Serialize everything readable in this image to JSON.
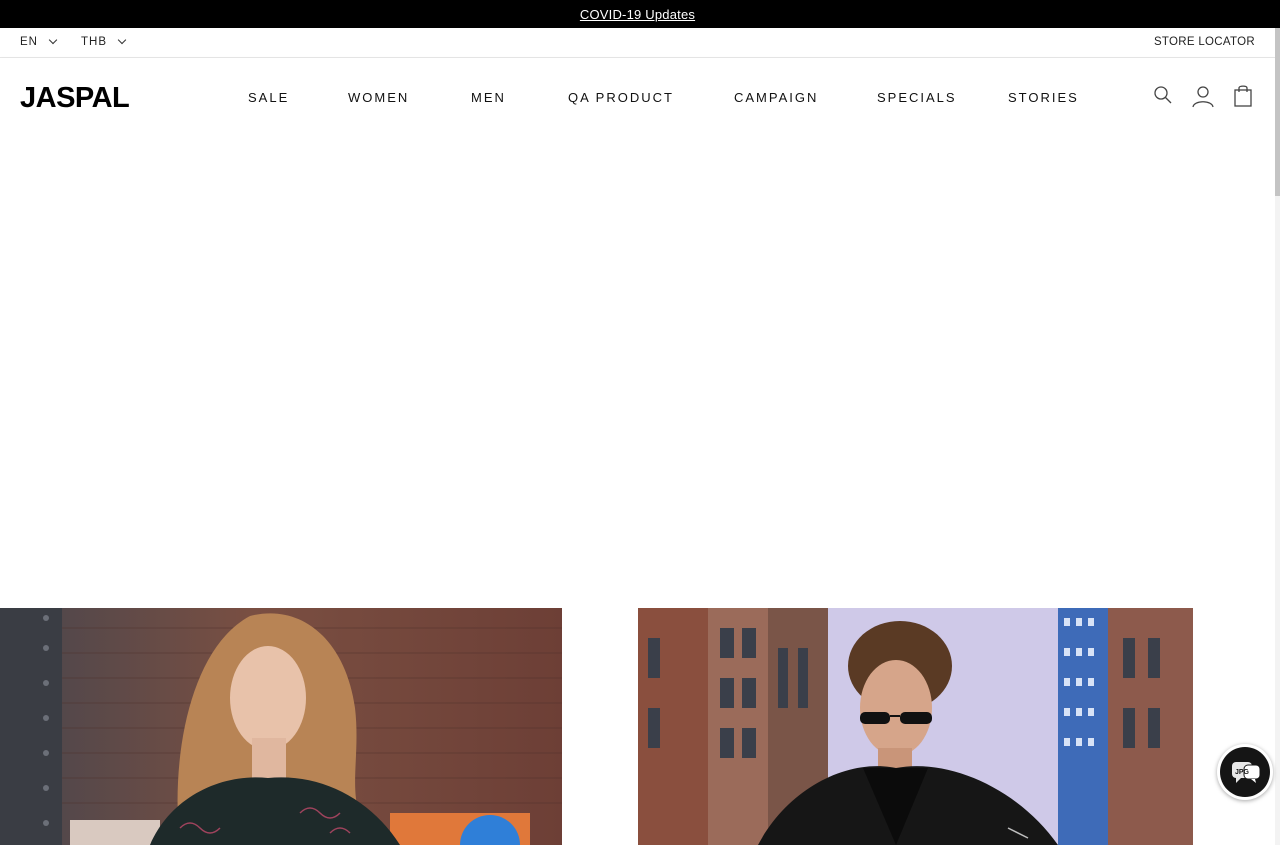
{
  "announcement": {
    "text": "COVID-19 Updates"
  },
  "utility": {
    "language": "EN",
    "currency": "THB",
    "store_locator": "STORE LOCATOR"
  },
  "header": {
    "logo": "JASPAL",
    "nav": [
      {
        "label": "SALE"
      },
      {
        "label": "WOMEN"
      },
      {
        "label": "MEN"
      },
      {
        "label": "QA PRODUCT"
      },
      {
        "label": "CAMPAIGN"
      },
      {
        "label": "SPECIALS"
      },
      {
        "label": "STORIES"
      }
    ],
    "icons": [
      "search-icon",
      "account-icon",
      "shopping-bag-icon"
    ]
  },
  "chat_widget": {
    "label": "JPG",
    "icon": "chat-bubble-icon"
  },
  "colors": {
    "announcement_bg": "#000000",
    "accent": "#111111"
  }
}
